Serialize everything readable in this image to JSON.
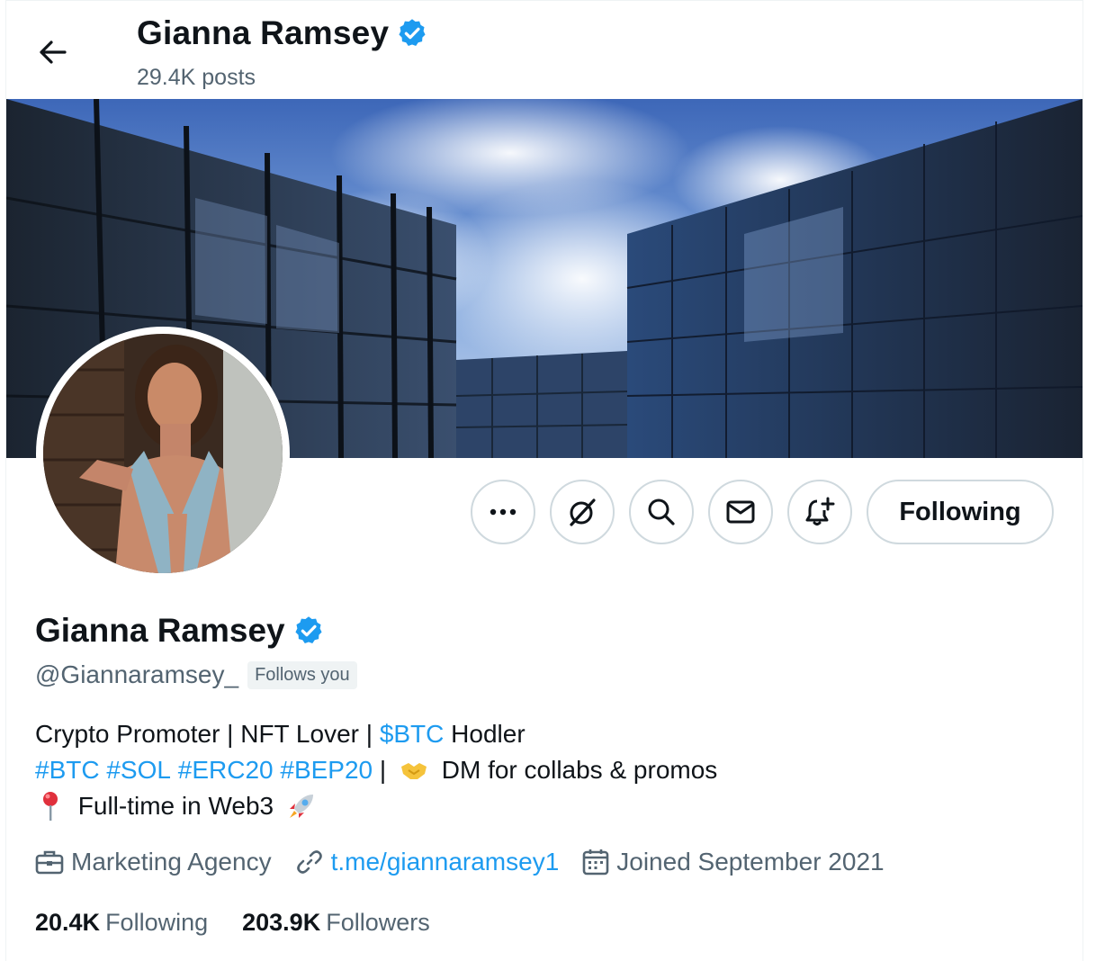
{
  "header": {
    "title": "Gianna Ramsey",
    "posts": "29.4K posts"
  },
  "profile": {
    "name": "Gianna Ramsey",
    "handle": "@Giannaramsey_",
    "follows_you": "Follows you",
    "verified": true
  },
  "actions": {
    "more_icon": "more-icon",
    "grok_icon": "grok-icon",
    "search_icon": "search-icon",
    "message_icon": "envelope-icon",
    "notify_icon": "bell-plus-icon",
    "following_label": "Following"
  },
  "bio": {
    "line1_a": "Crypto Promoter | NFT Lover | ",
    "line1_link": "$BTC",
    "line1_b": " Hodler",
    "line2_tags": [
      "#BTC",
      "#SOL",
      "#ERC20",
      "#BEP20"
    ],
    "line2_sep": " | ",
    "line2_b": " DM for collabs & promos",
    "line3": " Full-time in Web3 "
  },
  "meta": {
    "category": "Marketing Agency",
    "link": "t.me/giannaramsey1",
    "joined": "Joined September 2021"
  },
  "stats": {
    "following_count": "20.4K",
    "following_label": "Following",
    "followers_count": "203.9K",
    "followers_label": "Followers"
  },
  "colors": {
    "accent": "#1d9bf0",
    "text": "#0f1419",
    "muted": "#536471",
    "border": "#cfd9de"
  }
}
